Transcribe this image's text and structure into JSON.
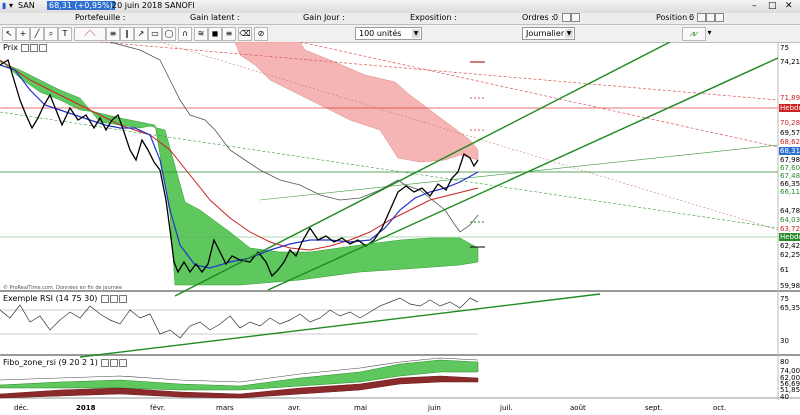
{
  "title_bar": {
    "symbol": "SAN",
    "price": "68,31 (+0,95%)",
    "date_name": "20 juin 2018 SANOFI"
  },
  "stats_bar": {
    "portefeuille": "Portefeuille :",
    "gain_latent": "Gain latent :",
    "gain_jour": "Gain Jour :",
    "exposition": "Exposition :",
    "ordres": "Ordres :",
    "ordres_value": "0",
    "position": "Position :",
    "position_value": "0"
  },
  "toolbar": {
    "quantity": "100 unités",
    "period": "Journalier"
  },
  "panels": {
    "price": "Prix",
    "rsi": "Exemple RSI (14 75 30)",
    "fibo": "Fibo_zone_rsi (9 20 2 1)",
    "watermark": "© ProRealTime.com. Données en fin de journée"
  },
  "price_axis": {
    "labels": [
      "75",
      "74,217",
      "71,895",
      "70,287",
      "69,570",
      "68,627",
      "68,31",
      "67,983",
      "67,60",
      "67,483",
      "66,357",
      "66,112",
      "64,780",
      "64,033",
      "63,727",
      "63",
      "62,427",
      "62,250",
      "61",
      "59,989"
    ],
    "hebdo": "Hebdo"
  },
  "rsi_axis": [
    "75",
    "65,352",
    "30"
  ],
  "fibo_axis": [
    "80",
    "74,000",
    "62,000",
    "56,697",
    "51,850",
    "40"
  ],
  "months": [
    "déc.",
    "2018",
    "févr.",
    "mars",
    "avr.",
    "mai",
    "juin",
    "juil.",
    "août",
    "sept.",
    "oct."
  ],
  "colors": {
    "accent": "#2f6fd0",
    "green_cloud": "#49c24a",
    "red_cloud": "#f0a0a0",
    "trend": "#1f8a1f",
    "hebdo": "#cc2222"
  },
  "chart_data": {
    "type": "line",
    "series": [
      {
        "values": [
          72.5,
          72.3,
          71.8,
          71.5,
          71.0,
          70.6,
          70.1,
          70.2,
          70.9,
          71.2,
          71.3,
          71.0,
          70.6,
          70.2,
          69.6,
          69.2,
          68.8,
          68.5,
          68.2,
          67.7,
          67.5,
          67.0,
          66.7,
          66.4,
          66.0,
          65.7,
          64.8,
          64.0,
          63.2,
          62.5,
          61.6,
          61.2,
          61.0,
          61.3,
          62.0,
          62.4,
          62.6,
          62.2,
          61.8,
          61.5,
          61.2,
          61.6,
          62.3,
          62.8,
          63.0,
          62.9,
          62.6,
          62.4,
          62.8,
          63.3,
          63.0,
          62.8,
          62.3,
          62.6,
          63.4,
          64.3,
          65.2,
          65.9,
          66.3,
          66.5,
          66.1,
          65.8,
          66.6,
          67.2,
          67.6,
          68.0,
          68.4,
          67.8,
          68.3
        ]
      }
    ],
    "ylim": [
      59.989,
      75
    ]
  }
}
